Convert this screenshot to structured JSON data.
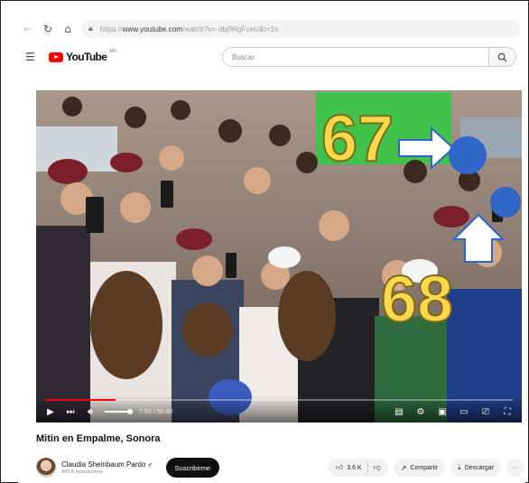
{
  "browser": {
    "back_icon": "arrow-left-icon",
    "reload_icon": "reload-icon",
    "home_icon": "home-icon",
    "lock_icon": "lock-icon",
    "url_prefix": "https://",
    "url_host": "www.youtube.com",
    "url_path": "/watch?v=-dbjfWgFceU&t=1s"
  },
  "header": {
    "logo_text": "YouTube",
    "country_code": "MX",
    "search_placeholder": "Buscar"
  },
  "video": {
    "overlay_numbers": [
      "67",
      "68"
    ],
    "progress_fraction": 0.15,
    "volume_fraction": 0.9,
    "time_text": "7:50 / 50:30"
  },
  "info": {
    "title": "Mitin en Empalme, Sonora",
    "channel_name": "Claudia Sheinbaum Pardo",
    "verified_icon": "verified-check-icon",
    "subscribers": "400 K suscriptores",
    "subscribe_label": "Suscribirme",
    "likes": "3.6 K",
    "share_label": "Compartir",
    "download_label": "Descargar",
    "more_label": "···"
  },
  "colors": {
    "brand_red": "#ff0000",
    "overlay_yellow": "#ffd94a",
    "marker_blue": "#2f66c8"
  }
}
